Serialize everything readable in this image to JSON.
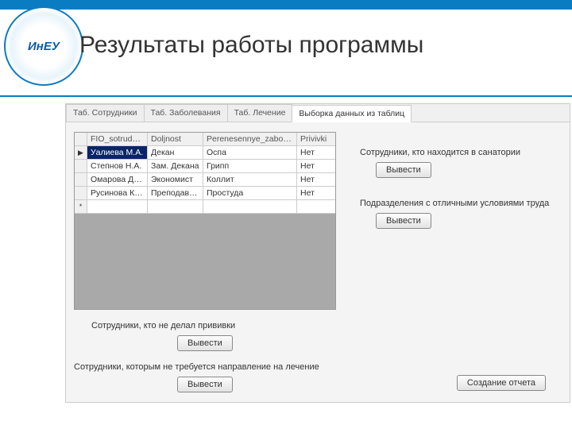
{
  "page": {
    "title": "Результаты работы программы",
    "logo_text": "ИнЕУ"
  },
  "tabs": {
    "items": [
      {
        "label": "Таб. Сотрудники"
      },
      {
        "label": "Таб. Заболевания"
      },
      {
        "label": "Таб. Лечение"
      },
      {
        "label": "Выборка данных из таблиц"
      }
    ],
    "active_index": 3
  },
  "grid": {
    "columns": {
      "fio": "FIO_sotrudnika",
      "doljnost": "Doljnost",
      "pereness": "Perenesennye_zaboleva",
      "privivki": "Privivki"
    },
    "rows": [
      {
        "marker": "▶",
        "fio": "Уалиева М.А.",
        "doljnost": "Декан",
        "pereness": "Оспа",
        "privivki": "Нет",
        "selected": true
      },
      {
        "marker": "",
        "fio": "Степнов Н.А.",
        "doljnost": "Зам. Декана",
        "pereness": "Грипп",
        "privivki": "Нет"
      },
      {
        "marker": "",
        "fio": "Омарова Д.И.",
        "doljnost": "Экономист",
        "pereness": "Коллит",
        "privivki": "Нет"
      },
      {
        "marker": "",
        "fio": "Русинова К.А.",
        "doljnost": "Преподават…",
        "pereness": "Простуда",
        "privivki": "Нет"
      },
      {
        "marker": "*",
        "fio": "",
        "doljnost": "",
        "pereness": "",
        "privivki": ""
      }
    ]
  },
  "sections": {
    "no_vaccine": {
      "label": "Сотрудники, кто не делал прививки",
      "button": "Вывести"
    },
    "no_treatment": {
      "label": "Сотрудники, которым не требуется направление на лечение",
      "button": "Вывести"
    },
    "in_sanatorium": {
      "label": "Сотрудники, кто находится в санатории",
      "button": "Вывести"
    },
    "good_conditions": {
      "label": "Подразделения с отличными условиями труда",
      "button": "Вывести"
    }
  },
  "report_button": "Создание отчета"
}
